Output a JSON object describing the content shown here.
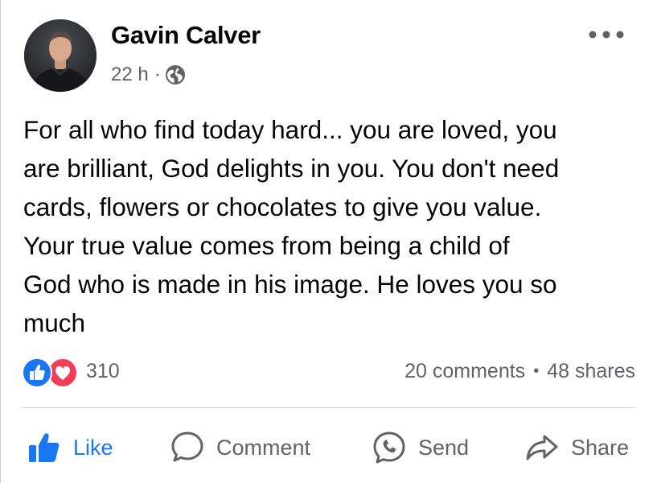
{
  "post": {
    "author": "Gavin Calver",
    "time": "22 h",
    "separator": "·",
    "audience_icon": "globe-icon",
    "more_icon": "more-options-icon",
    "text": "For all who find today hard... you are loved, you\nare brilliant, God delights in you. You don't need\ncards, flowers or chocolates to give you value.\nYour true value comes from being a child of\nGod who is made in his image. He loves you so\nmuch"
  },
  "stats": {
    "reactions": [
      "like-reaction-icon",
      "love-reaction-icon"
    ],
    "reaction_count": "310",
    "comments": "20 comments",
    "bullet": "•",
    "shares": "48 shares"
  },
  "actions": {
    "like": {
      "label": "Like",
      "icon": "thumbs-up-icon"
    },
    "comment": {
      "label": "Comment",
      "icon": "comment-icon"
    },
    "send": {
      "label": "Send",
      "icon": "messenger-icon"
    },
    "share": {
      "label": "Share",
      "icon": "share-arrow-icon"
    }
  },
  "colors": {
    "accent_blue": "#1877f2",
    "love_red": "#f33e58",
    "secondary_text": "#5f6368",
    "primary_text": "#050505"
  }
}
